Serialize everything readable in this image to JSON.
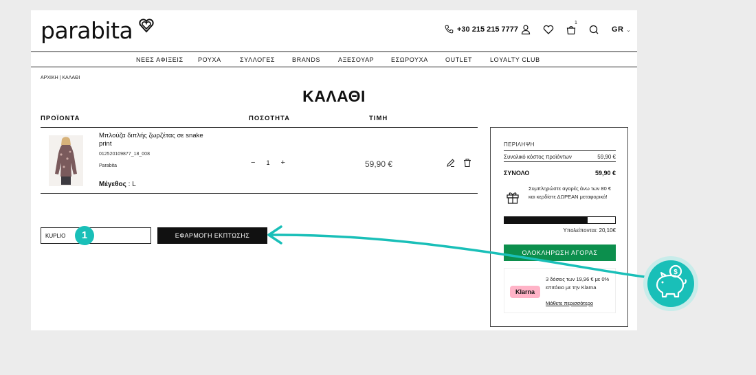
{
  "header": {
    "logo": "parabita",
    "phone": "+30 215 215 7777",
    "cart_count": "1",
    "language": "GR"
  },
  "nav": [
    "ΝΕΕΣ ΑΦΙΞΕΙΣ",
    "ΡΟΥΧΑ",
    "ΣΥΛΛΟΓΕΣ",
    "BRANDS",
    "ΑΞΕΣΟΥΑΡ",
    "ΕΣΩΡΟΥΧΑ",
    "OUTLET",
    "LOYALTY CLUB"
  ],
  "breadcrumb": "ΑΡΧΙΚΗ | ΚΑΛΑΘΙ",
  "page_title": "ΚΑΛΑΘΙ",
  "columns": {
    "products": "ΠΡΟΪΟΝΤΑ",
    "quantity": "ΠΟΣΟΤΗΤΑ",
    "price": "ΤΙΜΗ"
  },
  "item": {
    "name": "Μπλούζα διπλής ζωρζέτας σε snake print",
    "sku": "012520109877_18_008",
    "brand": "Parabita",
    "size_label": "Μέγεθος",
    "size_value": ": L",
    "qty_minus": "−",
    "qty": "1",
    "qty_plus": "+",
    "price": "59,90 €"
  },
  "coupon": {
    "value": "KUPLIO",
    "apply_label": "ΕΦΑΡΜΟΓΗ ΕΚΠΤΩΣΗΣ"
  },
  "summary": {
    "heading": "ΠΕΡΙΛΗΨΗ",
    "subtotal_label": "Συνολικό κόστος προϊόντων",
    "subtotal_value": "59,90 €",
    "total_label": "ΣΥΝΟΛΟ",
    "total_value": "59,90 €",
    "free_shipping_text": "Συμπληρώστε αγορές άνω των 80 € και κερδίστε ΔΩΡΕΑΝ μεταφορικά!",
    "progress_fraction": 0.749,
    "remaining": "Υπολείπονται: 20,10€",
    "checkout_label": "ΟΛΟΚΛΗΡΩΣΗ ΑΓΟΡΑΣ"
  },
  "klarna": {
    "logo": "Klarna",
    "text": "3 δόσεις των 19,96 € με 0% επιτόκιο με την Klarna",
    "link": "Μάθετε περισσότερο"
  },
  "annotation": {
    "step": "1",
    "coin_symbol": "$"
  },
  "colors": {
    "accent": "#19bfb8",
    "checkout": "#0c8f4d",
    "klarna": "#ffb3c7"
  }
}
